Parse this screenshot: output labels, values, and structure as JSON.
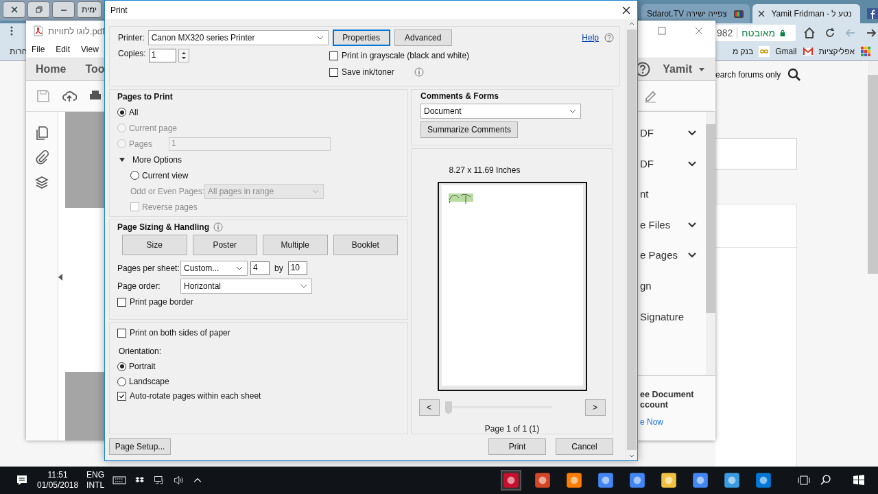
{
  "other_window": {
    "button": "ימית"
  },
  "browser": {
    "tabs": [
      {
        "title": "Sdarot.TV צפייה ישירה",
        "selected": false
      },
      {
        "title": "Yamit Fridman - נטע ל",
        "selected": true
      }
    ],
    "security": "מאובטח",
    "url": "982",
    "bookmarks": [
      "אפליקציות",
      "Gmail",
      "בנק מ"
    ],
    "bookmark_overflow": "חרות",
    "search_label": "earch forums only"
  },
  "acrobat": {
    "file_name": "לוגו לתוויות.pdf",
    "menu": [
      "File",
      "Edit",
      "View"
    ],
    "tabs": [
      "Home",
      "Too"
    ],
    "user": "Yamit",
    "tools": [
      {
        "label": "DF",
        "expandable": true
      },
      {
        "label": "DF",
        "expandable": true
      },
      {
        "label": "nt",
        "expandable": false
      },
      {
        "label": "e Files",
        "expandable": true
      },
      {
        "label": "e Pages",
        "expandable": true
      },
      {
        "label": "gn",
        "expandable": false
      },
      {
        "label": "Signature",
        "expandable": false
      }
    ],
    "promo": [
      "ee Document",
      "ccount"
    ],
    "promo_link": "e Now"
  },
  "dialog": {
    "title": "Print",
    "printer_label": "Printer:",
    "printer": "Canon MX320 series Printer",
    "buttons": [
      {
        "label": "Properties",
        "focused": true
      },
      {
        "label": "Advanced",
        "focused": false
      }
    ],
    "help": "Help",
    "copies_label": "Copies:",
    "copies": "1",
    "options": [
      {
        "label": "Print in grayscale (black and white)",
        "checked": false,
        "info": false
      },
      {
        "label": "Save ink/toner",
        "checked": false,
        "info": true
      }
    ],
    "pages_to_print": {
      "heading": "Pages to Print",
      "choices": [
        {
          "label": "All",
          "selected": true,
          "disabled": false
        },
        {
          "label": "Current page",
          "selected": false,
          "disabled": true
        },
        {
          "label": "Pages",
          "selected": false,
          "disabled": true
        }
      ],
      "pages_value": "1",
      "more_options": {
        "label": "More Options",
        "expanded": true
      },
      "current_view": {
        "label": "Current view",
        "selected": false
      },
      "odd_even_label": "Odd or Even Pages:",
      "odd_even": "All pages in range",
      "reverse": {
        "label": "Reverse pages",
        "checked": false
      }
    },
    "sizing": {
      "heading": "Page Sizing & Handling",
      "modes": [
        "Size",
        "Poster",
        "Multiple",
        "Booklet"
      ],
      "per_sheet_label": "Pages per sheet:",
      "per_sheet": "Custom...",
      "cols": "4",
      "by": "by",
      "rows": "10",
      "order_label": "Page order:",
      "order": "Horizontal",
      "border": {
        "label": "Print page border",
        "checked": false
      }
    },
    "duplex": {
      "label": "Print on both sides of paper",
      "checked": false
    },
    "orientation_label": "Orientation:",
    "orientation": [
      {
        "label": "Portrait",
        "selected": true
      },
      {
        "label": "Landscape",
        "selected": false
      }
    ],
    "auto_rotate": {
      "label": "Auto-rotate pages within each sheet",
      "checked": true
    },
    "comments": {
      "heading": "Comments & Forms",
      "value": "Document",
      "button": "Summarize Comments"
    },
    "preview": {
      "size": "8.27 x 11.69 Inches",
      "prev": "<",
      "next": ">",
      "slider": {
        "level": 0
      },
      "page": "Page 1 of 1 (1)"
    },
    "page_setup": "Page Setup...",
    "print": "Print",
    "cancel": "Cancel"
  },
  "taskbar": {
    "time": "11:51",
    "date": "01/05/2018",
    "lang": "ENG",
    "layout": "INTL"
  }
}
